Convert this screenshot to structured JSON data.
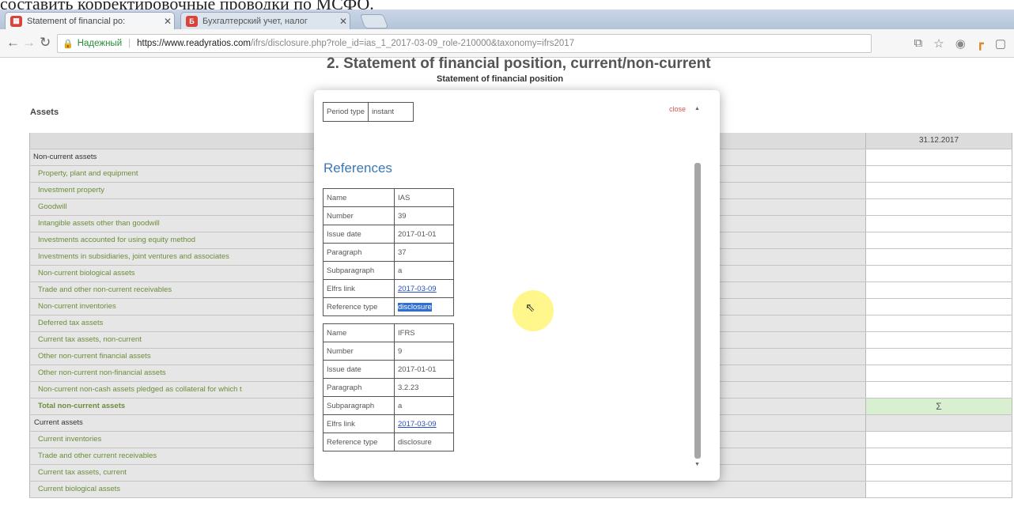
{
  "caption": "составить корректировочные проводки по МСФО.",
  "tabs": [
    {
      "label": "Statement of financial po:",
      "icon": "ratio-icon",
      "color": "#d9443a"
    },
    {
      "label": "Бухгалтерский учет, налог",
      "icon": "book-icon",
      "color": "#d9443a"
    }
  ],
  "address": {
    "secure_label": "Надежный",
    "host": "https://www.readyratios.com",
    "path": "/ifrs/disclosure.php?role_id=ias_1_2017-03-09_role-210000&taxonomy=ifrs2017"
  },
  "page": {
    "title": "2. Statement of financial position, current/non-current",
    "subtitle": "Statement of financial position",
    "assets_label": "Assets",
    "date_header": "31.12.2017",
    "rows": [
      {
        "label": "Non-current assets",
        "kind": "header",
        "value": ""
      },
      {
        "label": "Property, plant and equipment",
        "kind": "item",
        "value": ""
      },
      {
        "label": "Investment property",
        "kind": "item",
        "value": ""
      },
      {
        "label": "Goodwill",
        "kind": "item",
        "value": ""
      },
      {
        "label": "Intangible assets other than goodwill",
        "kind": "item",
        "value": ""
      },
      {
        "label": "Investments accounted for using equity method",
        "kind": "item",
        "value": ""
      },
      {
        "label": "Investments in subsidiaries, joint ventures and associates",
        "kind": "item",
        "value": ""
      },
      {
        "label": "Non-current biological assets",
        "kind": "item",
        "value": ""
      },
      {
        "label": "Trade and other non-current receivables",
        "kind": "item",
        "value": ""
      },
      {
        "label": "Non-current inventories",
        "kind": "item",
        "value": ""
      },
      {
        "label": "Deferred tax assets",
        "kind": "item",
        "value": ""
      },
      {
        "label": "Current tax assets, non-current",
        "kind": "item",
        "value": ""
      },
      {
        "label": "Other non-current financial assets",
        "kind": "item",
        "value": ""
      },
      {
        "label": "Other non-current non-financial assets",
        "kind": "item",
        "value": ""
      },
      {
        "label": "Non-current non-cash assets pledged as collateral for which t",
        "kind": "item",
        "value": ""
      },
      {
        "label": "Total non-current assets",
        "kind": "total",
        "value": "Σ"
      },
      {
        "label": "Current assets",
        "kind": "sect",
        "value": ""
      },
      {
        "label": "Current inventories",
        "kind": "item",
        "value": ""
      },
      {
        "label": "Trade and other current receivables",
        "kind": "item",
        "value": ""
      },
      {
        "label": "Current tax assets, current",
        "kind": "item",
        "value": ""
      },
      {
        "label": "Current biological assets",
        "kind": "item",
        "value": ""
      }
    ]
  },
  "modal": {
    "close_label": "close",
    "period_type_label": "Period type",
    "period_type_value": "instant",
    "references_title": "References",
    "references": [
      {
        "Name": "IAS",
        "Number": "39",
        "Issue date": "2017-01-01",
        "Paragraph": "37",
        "Subparagraph": "a",
        "Elfrs link": "2017-03-09",
        "Reference type": "disclosure"
      },
      {
        "Name": "IFRS",
        "Number": "9",
        "Issue date": "2017-01-01",
        "Paragraph": "3.2.23",
        "Subparagraph": "a",
        "Elfrs link": "2017-03-09",
        "Reference type": "disclosure"
      }
    ],
    "keys": [
      "Name",
      "Number",
      "Issue date",
      "Paragraph",
      "Subparagraph",
      "Elfrs link",
      "Reference type"
    ]
  }
}
